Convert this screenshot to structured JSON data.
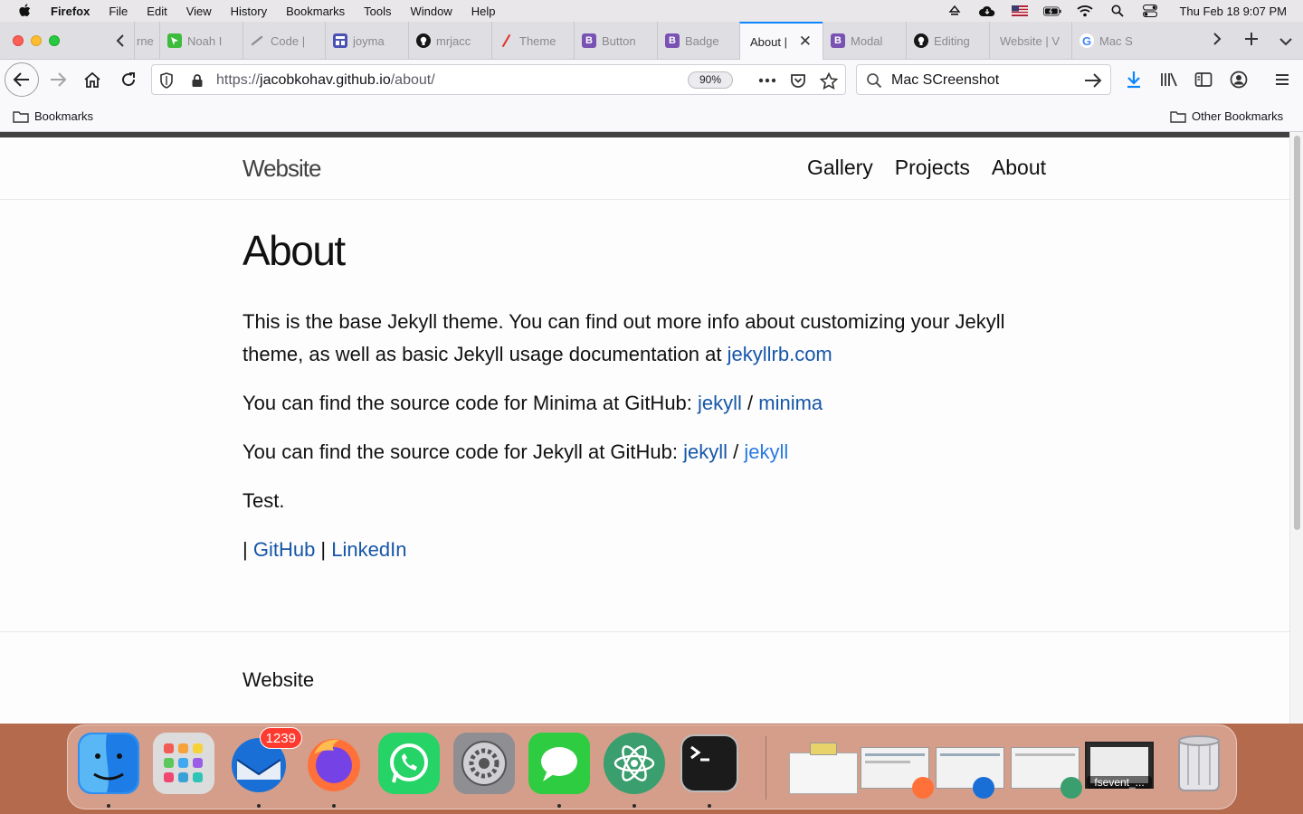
{
  "menubar": {
    "items": [
      "Firefox",
      "File",
      "Edit",
      "View",
      "History",
      "Bookmarks",
      "Tools",
      "Window",
      "Help"
    ],
    "clock": "Thu Feb 18  9:07 PM"
  },
  "tabs": [
    {
      "label": "rne",
      "favicon": "generic",
      "color": "#7d7d7d"
    },
    {
      "label": "Noah I",
      "favicon": "cursor-icon",
      "color": "#3dbb3d"
    },
    {
      "label": "Code |",
      "favicon": "pen-icon",
      "color": "#8f8f8f"
    },
    {
      "label": "joyma",
      "favicon": "layout-icon",
      "color": "#4c52b3"
    },
    {
      "label": "mrjacc",
      "favicon": "github-icon",
      "color": "#161616"
    },
    {
      "label": "Theme",
      "favicon": "brush-icon",
      "color": "#e0312a"
    },
    {
      "label": "Button",
      "favicon": "bootstrap-icon",
      "color": "#7952b3"
    },
    {
      "label": "Badge",
      "favicon": "bootstrap-icon",
      "color": "#7952b3"
    },
    {
      "label": "About |",
      "favicon": "none",
      "color": "#ffffff",
      "active": true
    },
    {
      "label": "Modal",
      "favicon": "bootstrap-icon",
      "color": "#7952b3"
    },
    {
      "label": "Editing",
      "favicon": "github-icon",
      "color": "#161616"
    },
    {
      "label": "Website | V",
      "favicon": "none",
      "color": "#ffffff"
    },
    {
      "label": "Mac S",
      "favicon": "google-icon",
      "color": "#4285f4"
    }
  ],
  "toolbar": {
    "url_proto": "https://",
    "url_host": "jacobkohav.github.io",
    "url_path": "/about/",
    "zoom": "90%",
    "search_query": "Mac SCreenshot"
  },
  "bookmarks": {
    "left": "Bookmarks",
    "right": "Other Bookmarks"
  },
  "site": {
    "title": "Website",
    "nav": [
      "Gallery",
      "Projects",
      "About"
    ],
    "heading": "About",
    "p1_text": "This is the base Jekyll theme. You can find out more info about customizing your Jekyll theme, as well as basic Jekyll usage documentation at ",
    "p1_link": "jekyllrb.com",
    "p2_text": "You can find the source code for Minima at GitHub: ",
    "p2_link1": "jekyll",
    "p2_sep": " / ",
    "p2_link2": "minima",
    "p3_text": "You can find the source code for Jekyll at GitHub: ",
    "p3_link1": "jekyll",
    "p3_sep": " / ",
    "p3_link2": "jekyll",
    "p4_text": "Test.",
    "p5_bar1": "| ",
    "p5_link1": "GitHub",
    "p5_bar2": " | ",
    "p5_link2": "LinkedIn",
    "footer_title": "Website"
  },
  "dock": {
    "apps": [
      "Finder",
      "Launchpad",
      "Thunderbird",
      "Firefox",
      "WhatsApp",
      "System Preferences",
      "Messages",
      "Atom",
      "Terminal"
    ],
    "thunderbird_badge": "1239",
    "fsevent_label": "fsevent_..."
  },
  "colors": {
    "link": "#2a7ae2",
    "link_visited": "#1756a9",
    "accent": "#0a84ff"
  }
}
